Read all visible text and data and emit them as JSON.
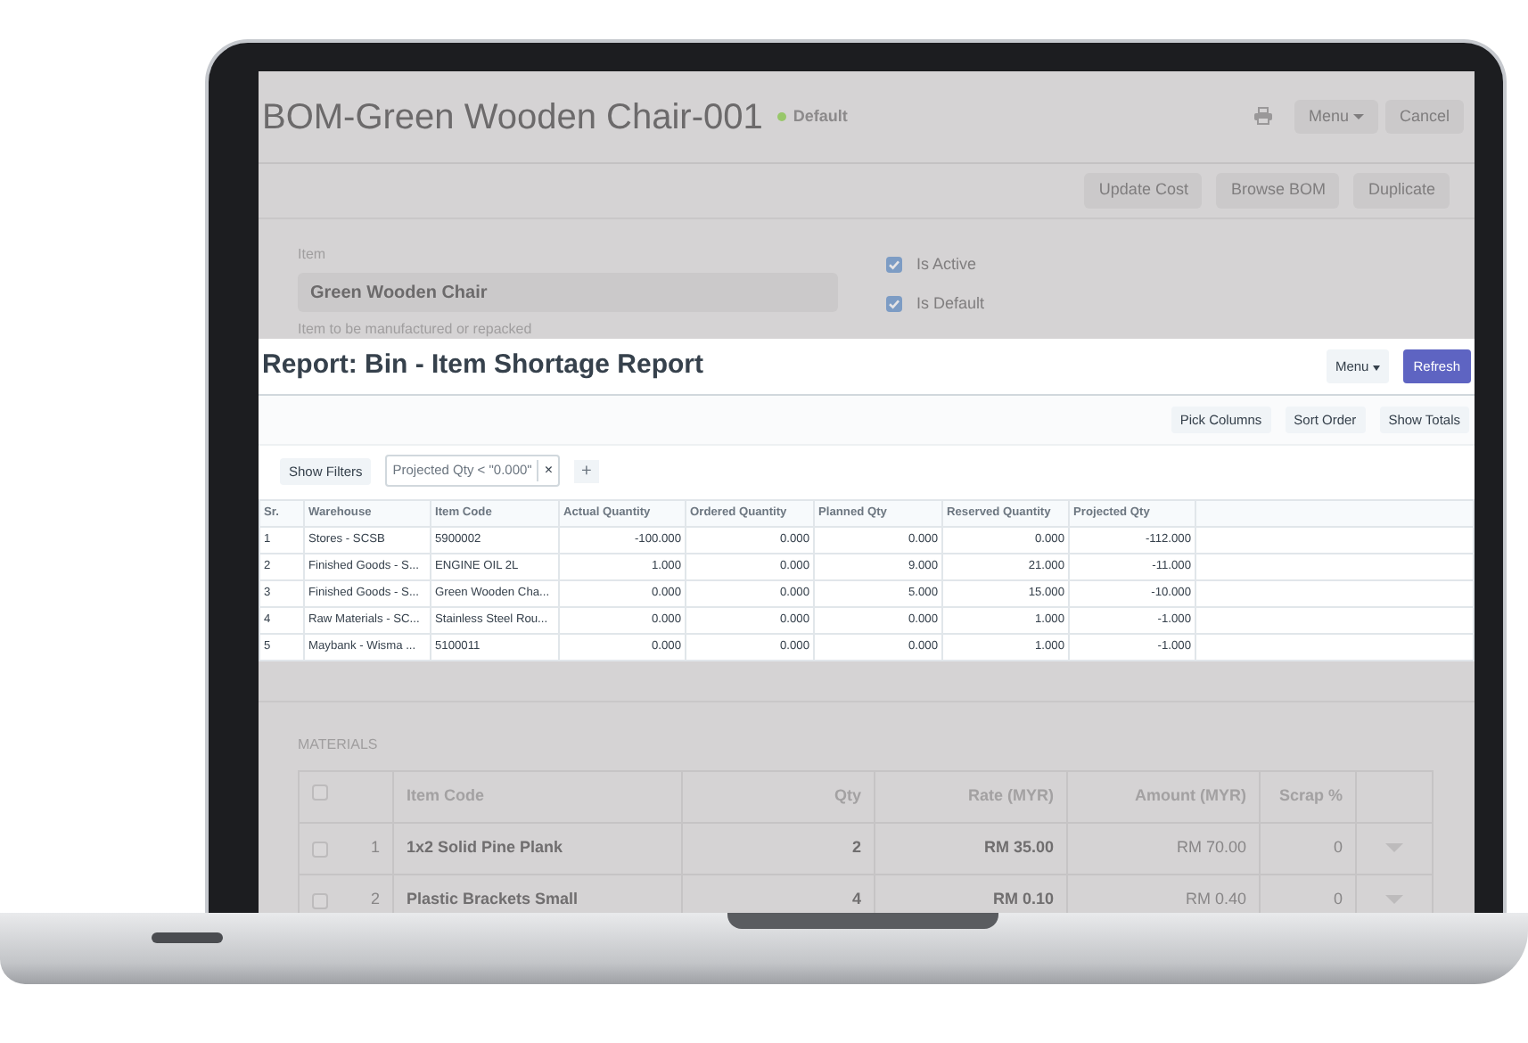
{
  "bom": {
    "title": "BOM-Green Wooden Chair-001",
    "indicator": "Default",
    "menu_button": "Menu",
    "cancel_button": "Cancel",
    "actions": [
      "Update Cost",
      "Browse BOM",
      "Duplicate"
    ],
    "item_field": {
      "label": "Item",
      "value": "Green Wooden Chair",
      "help": "Item to be manufactured or repacked"
    },
    "checks": [
      {
        "label": "Is Active",
        "checked": true
      },
      {
        "label": "Is Default",
        "checked": true
      }
    ],
    "materials": {
      "heading": "MATERIALS",
      "select_all": {
        "checked": false
      },
      "columns": [
        "Item Code",
        "Qty",
        "Rate (MYR)",
        "Amount (MYR)",
        "Scrap %"
      ],
      "rows": [
        {
          "checked": false,
          "no": "1",
          "item_code": "1x2 Solid Pine Plank",
          "qty": "2",
          "rate": "RM 35.00",
          "amount": "RM 70.00",
          "scrap": "0"
        },
        {
          "checked": false,
          "no": "2",
          "item_code": "Plastic Brackets Small",
          "qty": "4",
          "rate": "RM 0.10",
          "amount": "RM 0.40",
          "scrap": "0"
        }
      ]
    }
  },
  "report": {
    "title": "Report: Bin - Item Shortage Report",
    "menu_button": "Menu",
    "refresh_button": "Refresh",
    "tools": [
      "Pick Columns",
      "Sort Order",
      "Show Totals"
    ],
    "show_filters": "Show Filters",
    "filters": [
      "Projected Qty < \"0.000\""
    ],
    "remove_symbol": "×",
    "add_symbol": "+",
    "columns": [
      "Sr.",
      "Warehouse",
      "Item Code",
      "Actual Quantity",
      "Ordered Quantity",
      "Planned Qty",
      "Reserved Quantity",
      "Projected Qty"
    ],
    "rows": [
      [
        "1",
        "Stores - SCSB",
        "5900002",
        "-100.000",
        "0.000",
        "0.000",
        "0.000",
        "-112.000"
      ],
      [
        "2",
        "Finished Goods - S...",
        "ENGINE OIL 2L",
        "1.000",
        "0.000",
        "9.000",
        "21.000",
        "-11.000"
      ],
      [
        "3",
        "Finished Goods - S...",
        "Green Wooden Cha...",
        "0.000",
        "0.000",
        "5.000",
        "15.000",
        "-10.000"
      ],
      [
        "4",
        "Raw Materials - SC...",
        "Stainless Steel Rou...",
        "0.000",
        "0.000",
        "0.000",
        "1.000",
        "-1.000"
      ],
      [
        "5",
        "Maybank - Wisma ...",
        "5100011",
        "0.000",
        "0.000",
        "0.000",
        "1.000",
        "-1.000"
      ]
    ]
  }
}
